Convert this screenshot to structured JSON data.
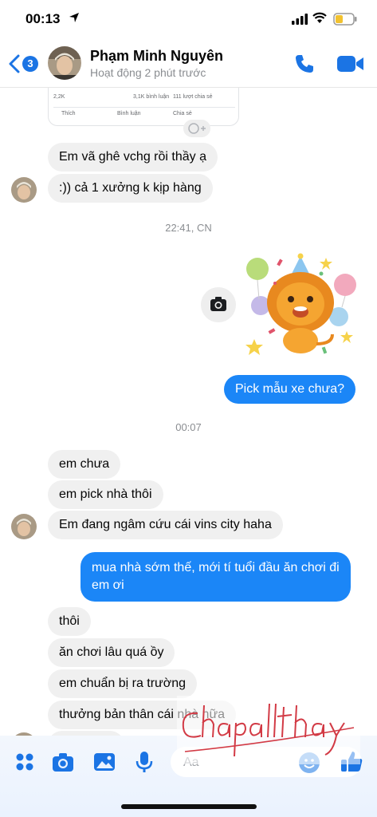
{
  "status_bar": {
    "time": "00:13"
  },
  "header": {
    "back_count": "3",
    "contact_name": "Phạm Minh Nguyên",
    "active_status": "Hoạt động 2 phút trước",
    "icons": [
      "back-chevron-icon",
      "phone-icon",
      "video-camera-icon"
    ]
  },
  "shared_post": {
    "reactions": "2,2K",
    "comments": "3,1K bình luận",
    "shares": "111 lượt chia sẻ",
    "like_label": "Thích",
    "comment_label": "Bình luận",
    "share_label": "Chia sẻ"
  },
  "messages": [
    {
      "side": "in",
      "text": "Em vã ghê vchg rồi thầy ạ"
    },
    {
      "side": "in",
      "text": ":)) cả 1 xưởng k kịp hàng"
    },
    {
      "type": "time",
      "text": "22:41, CN"
    },
    {
      "side": "out",
      "type": "sticker",
      "sticker": "lion-party-sticker"
    },
    {
      "side": "out",
      "text": "Pick mẫu xe chưa?"
    },
    {
      "type": "time",
      "text": "00:07"
    },
    {
      "side": "in",
      "text": "em chưa"
    },
    {
      "side": "in",
      "text": "em pick nhà thôi"
    },
    {
      "side": "in",
      "text": "Em đang ngâm cứu cái vins city haha"
    },
    {
      "side": "out",
      "text_line1": "mua nhà sớm thế, mới tí tuổi đầu ăn chơi đi",
      "text_line2": "em ơi"
    },
    {
      "side": "in",
      "text": "thôi"
    },
    {
      "side": "in",
      "text": "ăn chơi lâu quá ồy"
    },
    {
      "side": "in",
      "text": "em chuẩn bị ra trường"
    },
    {
      "side": "in",
      "text": "thưởng bản thân cái nhà nữa"
    }
  ],
  "composer": {
    "placeholder": "Aa",
    "icons": [
      "apps-grid-icon",
      "camera-icon",
      "gallery-icon",
      "microphone-icon",
      "emoji-icon",
      "thumbs-up-icon"
    ]
  },
  "watermark_signature": "Chapallthay",
  "colors": {
    "accent": "#1b86f7",
    "incoming_bubble": "#f0f0f0",
    "signature": "#d23a45"
  }
}
